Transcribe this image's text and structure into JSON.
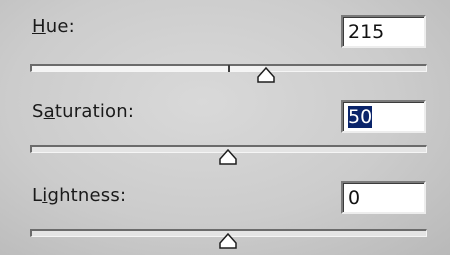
{
  "sliders": [
    {
      "id": "hue",
      "label_mnemonic": "H",
      "label_rest": "ue:",
      "value": "215",
      "selected": false,
      "range": [
        -180,
        180
      ],
      "thumb_value": 35
    },
    {
      "id": "saturation",
      "label_prefix": "S",
      "label_mnemonic": "a",
      "label_rest": "turation:",
      "value": "50",
      "selected": true,
      "range": [
        -100,
        100
      ],
      "thumb_value": 0
    },
    {
      "id": "lightness",
      "label_prefix": "L",
      "label_mnemonic": "i",
      "label_rest": "ghtness:",
      "value": "0",
      "selected": false,
      "range": [
        -100,
        100
      ],
      "thumb_value": 0
    }
  ],
  "colors": {
    "selection_background": "#0a246a",
    "selection_text": "#ffffff"
  }
}
